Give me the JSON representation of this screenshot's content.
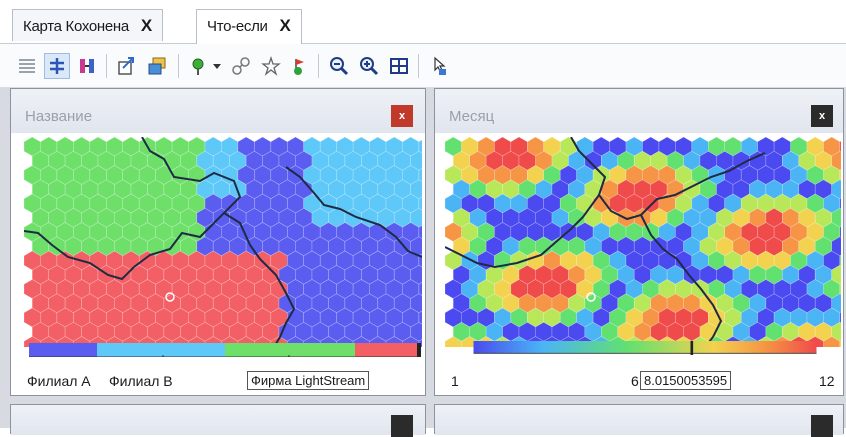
{
  "tabs": [
    {
      "label": "Карта Кохонена",
      "close": "X"
    },
    {
      "label": "Что-если",
      "close": "X"
    }
  ],
  "toolbar": {
    "icons": [
      "grid-icon",
      "select-icon",
      "columns-icon",
      "export-icon",
      "copy-icon",
      "pin-icon",
      "dropdown-icon",
      "link-icon",
      "star-icon",
      "flag-icon",
      "zoom-out-icon",
      "zoom-in-icon",
      "fit-icon",
      "cursor-icon"
    ]
  },
  "panels": {
    "left": {
      "title": "Название",
      "close": "x",
      "close_color": "#c0392b",
      "legend_labels": [
        "Филиал А",
        "Филиал В"
      ],
      "tooltip": "Фирма LightStream",
      "category_colors": {
        "Филиал А": "#5b5df0",
        "Филиал В": "#5ec8f8",
        "third": "#6ee06a",
        "fourth": "#f26065"
      }
    },
    "right": {
      "title": "Месяц",
      "close": "x",
      "close_color": "#2b2b2b",
      "scale_min": "1",
      "scale_mid": "6",
      "scale_max": "12",
      "tooltip": "8.0150053595"
    }
  },
  "colors": {
    "accent": "#1f2b44",
    "marker": "#ffffff"
  }
}
